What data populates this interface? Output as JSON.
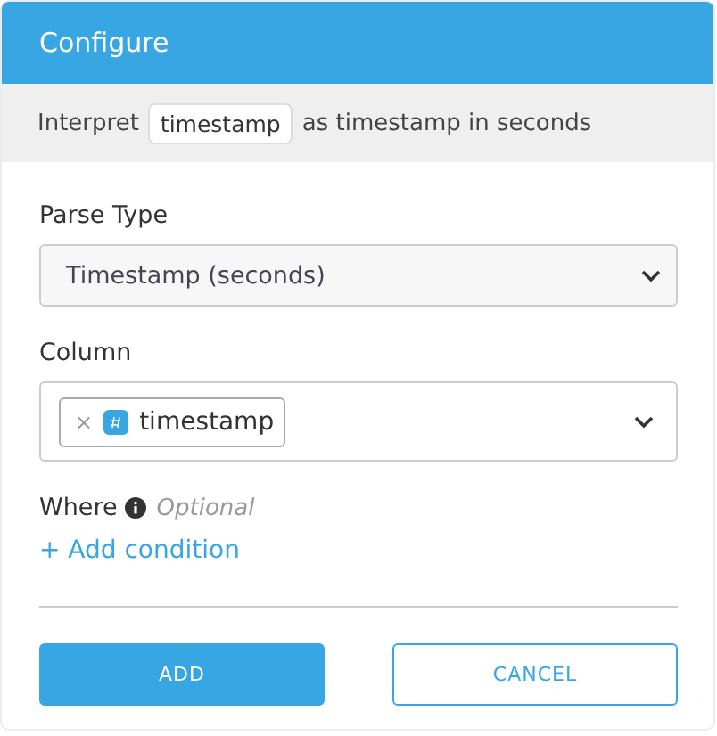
{
  "window": {
    "title": "Configure"
  },
  "summary": {
    "prefix": "Interpret",
    "column": "timestamp",
    "suffix": "as timestamp in seconds"
  },
  "parse_type": {
    "label": "Parse Type",
    "value": "Timestamp (seconds)"
  },
  "column": {
    "label": "Column",
    "tags": [
      {
        "label": "timestamp",
        "remove": "×"
      }
    ]
  },
  "where": {
    "label": "Where",
    "hint": "Optional",
    "link": "+ Add condition"
  },
  "buttons": [
    {
      "label": "ADD",
      "kind": "primary"
    },
    {
      "label": "CANCEL",
      "kind": "secondary"
    }
  ]
}
